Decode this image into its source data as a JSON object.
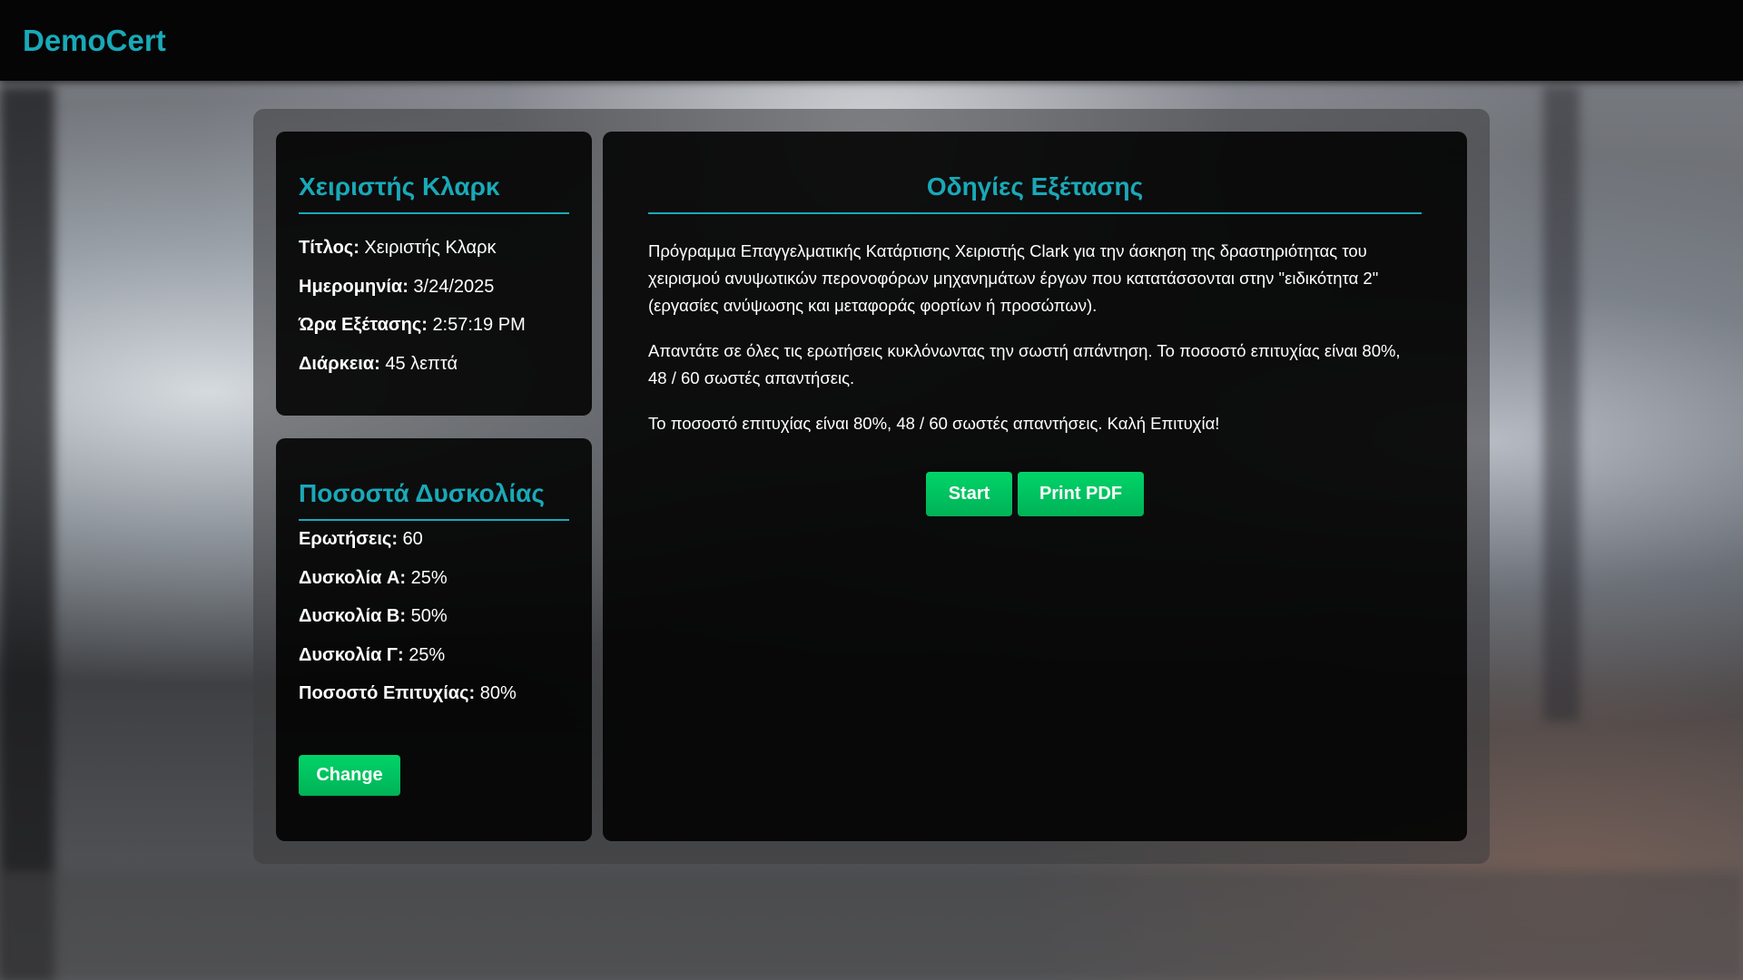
{
  "app": {
    "brand": "DemoCert"
  },
  "colors": {
    "accent": "#19a9b8",
    "button": "#00c060"
  },
  "candidate_card": {
    "title": "Χειριστής Κλαρκ",
    "rows": [
      {
        "label": "Τίτλος:",
        "value": "Χειριστής Κλαρκ"
      },
      {
        "label": "Ημερομηνία:",
        "value": "3/24/2025"
      },
      {
        "label": "Ώρα Εξέτασης:",
        "value": "2:57:19 PM"
      },
      {
        "label": "Διάρκεια:",
        "value": "45 λεπτά"
      }
    ]
  },
  "difficulty_card": {
    "title": "Ποσοστά Δυσκολίας",
    "rows": [
      {
        "label": "Ερωτήσεις:",
        "value": "60"
      },
      {
        "label": "Δυσκολία A:",
        "value": "25%"
      },
      {
        "label": "Δυσκολία B:",
        "value": "50%"
      },
      {
        "label": "Δυσκολία Γ:",
        "value": "25%"
      },
      {
        "label": "Ποσοστό Επιτυχίας:",
        "value": "80%"
      }
    ],
    "change_label": "Change"
  },
  "instructions": {
    "title": "Οδηγίες Εξέτασης",
    "paragraphs": [
      "Πρόγραμμα Επαγγελματικής Κατάρτισης Χειριστής Clark για την άσκηση της δραστηριότητας του χειρισμού ανυψωτικών περονοφόρων μηχανημάτων έργων που κατατάσσονται στην \"ειδικότητα 2\" (εργασίες ανύψωσης και μεταφοράς φορτίων ή προσώπων).",
      "Απαντάτε σε όλες τις ερωτήσεις κυκλόνωντας την σωστή απάντηση. Το ποσοστό επιτυχίας είναι 80%, 48 / 60 σωστές απαντήσεις.",
      "Το ποσοστό επιτυχίας είναι 80%, 48 / 60 σωστές απαντήσεις. Καλή Επιτυχία!"
    ],
    "start_label": "Start",
    "pdf_label": "Print PDF"
  }
}
